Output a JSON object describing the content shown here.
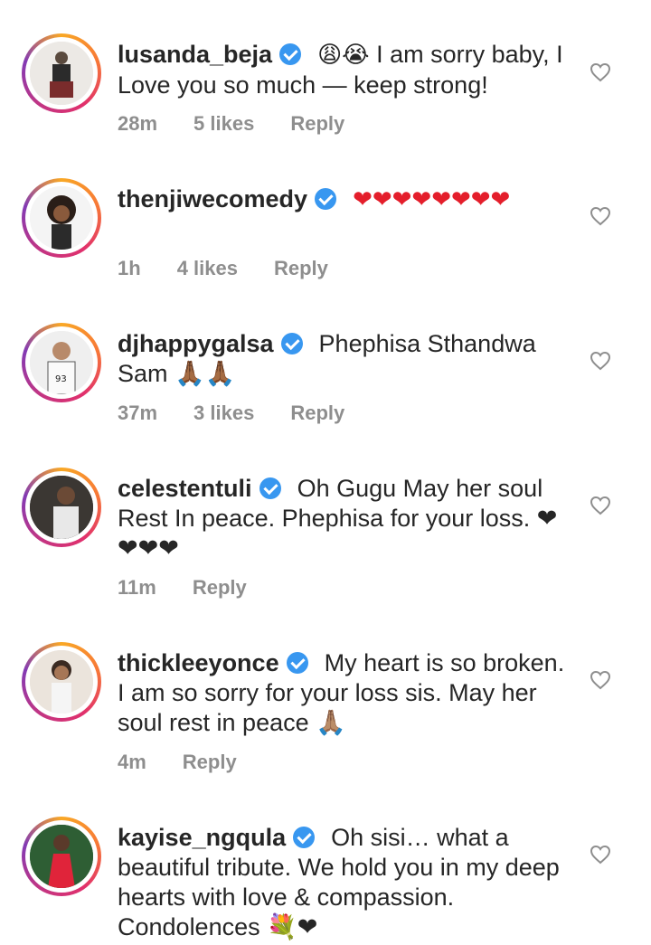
{
  "comments": [
    {
      "username": "lusanda_beja",
      "text_prefix": "😩😭",
      "text": " I am sorry baby, I Love you so much — keep strong!",
      "time": "28m",
      "likes": "5 likes",
      "reply": "Reply",
      "avatar_color": "#6b5a4e"
    },
    {
      "username": "thenjiwecomedy",
      "text_prefix": "❤❤❤❤❤❤❤❤",
      "text": "",
      "time": "1h",
      "likes": "4 likes",
      "reply": "Reply",
      "avatar_color": "#3a2a22"
    },
    {
      "username": "djhappygalsa",
      "text_prefix": "",
      "text": "Phephisa Sthandwa Sam 🙏🏾🙏🏾",
      "time": "37m",
      "likes": "3 likes",
      "reply": "Reply",
      "avatar_color": "#d8d8d8"
    },
    {
      "username": "celestentuli",
      "text_prefix": "",
      "text": "Oh Gugu May her soul Rest In peace. Phephisa for your loss. ❤❤❤❤",
      "time": "11m",
      "likes": "",
      "reply": "Reply",
      "avatar_color": "#4a4540"
    },
    {
      "username": "thickleeyonce",
      "text_prefix": "",
      "text": "My heart is so broken. I am so sorry for your loss sis. May her soul rest in peace 🙏🏽",
      "time": "4m",
      "likes": "",
      "reply": "Reply",
      "avatar_color": "#c9a98a"
    },
    {
      "username": "kayise_ngqula",
      "text_prefix": "",
      "text": "Oh sisi… what a beautiful tribute. We hold you in my deep hearts with love & compassion. Condolences 💐❤",
      "time": "",
      "likes": "",
      "reply": "",
      "avatar_color": "#2f6b3a"
    }
  ],
  "colors": {
    "verified": "#3897f0",
    "meta": "#8e8e8e",
    "heart": "#e41e2b"
  }
}
